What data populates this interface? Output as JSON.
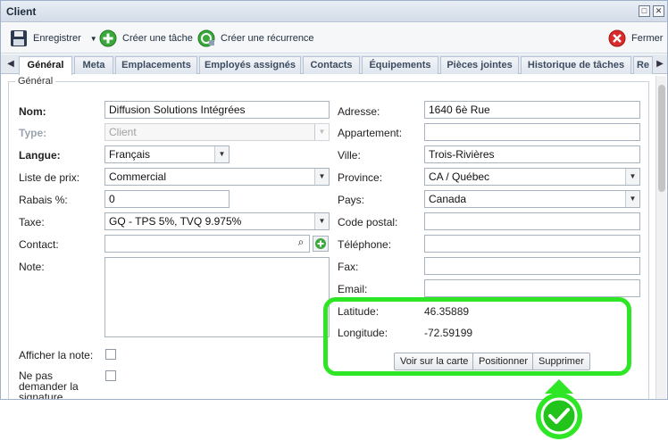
{
  "window": {
    "title": "Client"
  },
  "toolbar": {
    "save": "Enregistrer",
    "create_task": "Créer une tâche",
    "create_recurrence": "Créer une récurrence",
    "close": "Fermer"
  },
  "tabs": [
    "Général",
    "Meta",
    "Emplacements",
    "Employés assignés",
    "Contacts",
    "Équipements",
    "Pièces jointes",
    "Historique de tâches",
    "Re"
  ],
  "section": {
    "legend": "Général"
  },
  "left": {
    "name_label": "Nom:",
    "name_value": "Diffusion Solutions Intégrées",
    "type_label": "Type:",
    "type_value": "Client",
    "language_label": "Langue:",
    "language_value": "Français",
    "pricelist_label": "Liste de prix:",
    "pricelist_value": "Commercial",
    "discount_label": "Rabais %:",
    "discount_value": "0",
    "tax_label": "Taxe:",
    "tax_value": "GQ - TPS 5%, TVQ 9.975%",
    "contact_label": "Contact:",
    "contact_value": "",
    "note_label": "Note:",
    "show_note_label": "Afficher la note:",
    "no_signature_label": "Ne pas demander la signature obligatoire:"
  },
  "right": {
    "address_label": "Adresse:",
    "address_value": "1640 6è Rue",
    "apartment_label": "Appartement:",
    "apartment_value": "",
    "city_label": "Ville:",
    "city_value": "Trois-Rivières",
    "province_label": "Province:",
    "province_value": "CA / Québec",
    "country_label": "Pays:",
    "country_value": "Canada",
    "postal_label": "Code postal:",
    "postal_value": "",
    "phone_label": "Téléphone:",
    "phone_value": "",
    "fax_label": "Fax:",
    "fax_value": "",
    "email_label": "Email:",
    "email_value": "",
    "latitude_label": "Latitude:",
    "latitude_value": "46.35889",
    "longitude_label": "Longitude:",
    "longitude_value": "-72.59199",
    "view_map_button": "Voir sur la carte",
    "position_button": "Positionner",
    "delete_button": "Supprimer"
  },
  "colors": {
    "highlight": "#2ee626",
    "check_fill": "#22c41b"
  }
}
